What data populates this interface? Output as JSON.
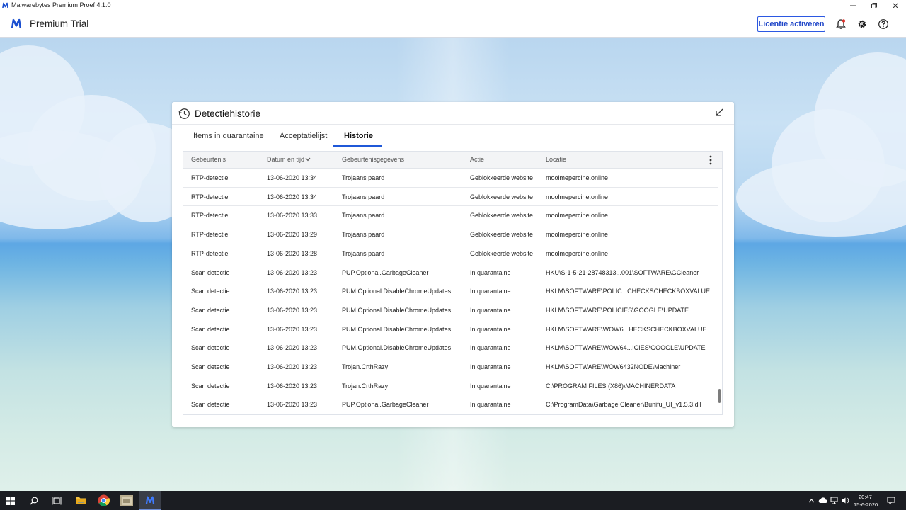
{
  "window": {
    "title": "Malwarebytes Premium Proef  4.1.0"
  },
  "header": {
    "brand": "Premium Trial",
    "activate_label": "Licentie activeren",
    "icons": [
      "bell-icon",
      "gear-icon",
      "help-icon"
    ]
  },
  "dialog": {
    "title": "Detectiehistorie",
    "tabs": [
      {
        "label": "Items in quarantaine",
        "active": false
      },
      {
        "label": "Acceptatielijst",
        "active": false
      },
      {
        "label": "Historie",
        "active": true
      }
    ]
  },
  "table": {
    "columns": [
      "Gebeurtenis",
      "Datum en tijd",
      "Gebeurtenisgegevens",
      "Actie",
      "Locatie"
    ],
    "sort_column": "Datum en tijd",
    "rows": [
      [
        "RTP-detectie",
        "13-06-2020 13:34",
        "Trojaans paard",
        "Geblokkeerde website",
        "moolmepercine.online"
      ],
      [
        "RTP-detectie",
        "13-06-2020 13:34",
        "Trojaans paard",
        "Geblokkeerde website",
        "moolmepercine.online"
      ],
      [
        "RTP-detectie",
        "13-06-2020 13:33",
        "Trojaans paard",
        "Geblokkeerde website",
        "moolmepercine.online"
      ],
      [
        "RTP-detectie",
        "13-06-2020 13:29",
        "Trojaans paard",
        "Geblokkeerde website",
        "moolmepercine.online"
      ],
      [
        "RTP-detectie",
        "13-06-2020 13:28",
        "Trojaans paard",
        "Geblokkeerde website",
        "moolmepercine.online"
      ],
      [
        "Scan detectie",
        "13-06-2020 13:23",
        "PUP.Optional.GarbageCleaner",
        "In quarantaine",
        "HKU\\S-1-5-21-28748313...001\\SOFTWARE\\GCleaner"
      ],
      [
        "Scan detectie",
        "13-06-2020 13:23",
        "PUM.Optional.DisableChromeUpdates",
        "In quarantaine",
        "HKLM\\SOFTWARE\\POLIC...CHECKSCHECKBOXVALUE"
      ],
      [
        "Scan detectie",
        "13-06-2020 13:23",
        "PUM.Optional.DisableChromeUpdates",
        "In quarantaine",
        "HKLM\\SOFTWARE\\POLICIES\\GOOGLE\\UPDATE"
      ],
      [
        "Scan detectie",
        "13-06-2020 13:23",
        "PUM.Optional.DisableChromeUpdates",
        "In quarantaine",
        "HKLM\\SOFTWARE\\WOW6...HECKSCHECKBOXVALUE"
      ],
      [
        "Scan detectie",
        "13-06-2020 13:23",
        "PUM.Optional.DisableChromeUpdates",
        "In quarantaine",
        "HKLM\\SOFTWARE\\WOW64...ICIES\\GOOGLE\\UPDATE"
      ],
      [
        "Scan detectie",
        "13-06-2020 13:23",
        "Trojan.CrthRazy",
        "In quarantaine",
        "HKLM\\SOFTWARE\\WOW6432NODE\\Machiner"
      ],
      [
        "Scan detectie",
        "13-06-2020 13:23",
        "Trojan.CrthRazy",
        "In quarantaine",
        "C:\\PROGRAM FILES (X86)\\MACHINERDATA"
      ],
      [
        "Scan detectie",
        "13-06-2020 13:23",
        "PUP.Optional.GarbageCleaner",
        "In quarantaine",
        "C:\\ProgramData\\Garbage Cleaner\\Bunifu_UI_v1.5.3.dll"
      ]
    ]
  },
  "taskbar": {
    "apps": [
      "start-icon",
      "search-icon",
      "task-view-icon",
      "file-explorer-icon",
      "chrome-icon",
      "app-thumbnail-icon",
      "malwarebytes-icon"
    ],
    "time": "20:47",
    "date": "15-6-2020"
  },
  "colors": {
    "accent": "#1f58d8",
    "brand": "#1a4fd0"
  }
}
